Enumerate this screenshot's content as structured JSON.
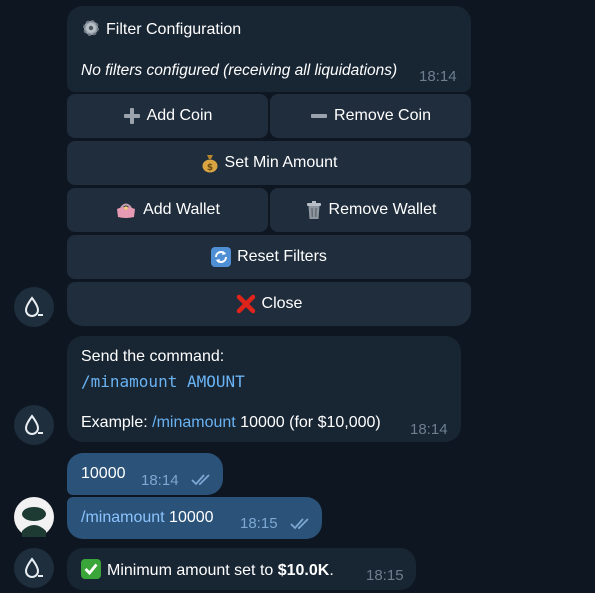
{
  "msg1": {
    "title_icon": "gear-icon",
    "title": "Filter Configuration",
    "subtitle": "No filters configured (receiving all liquidations)",
    "time": "18:14",
    "buttons": {
      "add_coin": {
        "icon": "plus-icon",
        "label": "Add Coin"
      },
      "remove_coin": {
        "icon": "minus-icon",
        "label": "Remove Coin"
      },
      "set_min": {
        "icon": "money-bag-icon",
        "label": "Set Min Amount"
      },
      "add_wallet": {
        "icon": "purse-icon",
        "label": "Add Wallet"
      },
      "remove_wallet": {
        "icon": "trash-icon",
        "label": "Remove Wallet"
      },
      "reset": {
        "icon": "refresh-icon",
        "label": "Reset Filters"
      },
      "close": {
        "icon": "cross-icon",
        "label": "Close"
      }
    }
  },
  "msg2": {
    "line1": "Send the command:",
    "command": "/minamount AMOUNT",
    "example_prefix": "Example: ",
    "example_cmd": "/minamount",
    "example_rest": " 10000 (for $10,000)",
    "time": "18:14"
  },
  "out1": {
    "text": "10000",
    "time": "18:14"
  },
  "out2": {
    "cmd": "/minamount",
    "rest": " 10000",
    "time": "18:15"
  },
  "msg3": {
    "icon": "check-mark-icon",
    "prefix": "Minimum amount set to ",
    "bold": "$10.0K",
    "suffix": ".",
    "time": "18:15"
  },
  "colors": {
    "background": "#0e1621",
    "incoming_bubble": "#182533",
    "outgoing_bubble": "#2b5278",
    "keyboard_button": "#1f2d3c",
    "link": "#6ab3f3"
  }
}
